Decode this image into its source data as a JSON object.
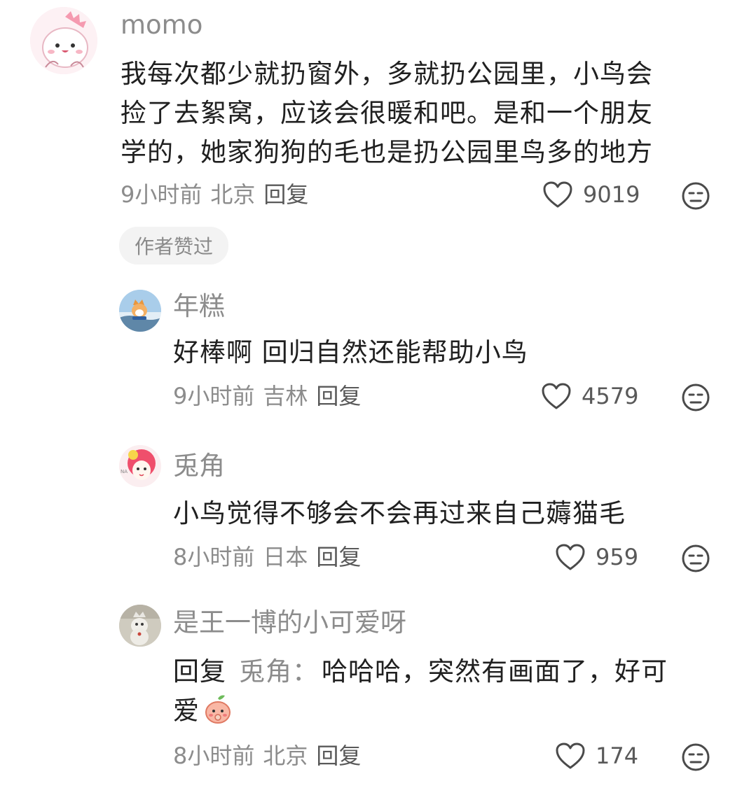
{
  "comments": [
    {
      "username": "momo",
      "content_lines": [
        "我每次都少就扔窗外，多就扔公园里，小鸟会",
        "捡了去絮窝，应该会很暖和吧。是和一个朋友",
        "学的，她家狗狗的毛也是扔公园里鸟多的地方"
      ],
      "time": "9小时前",
      "location": "北京",
      "reply_label": "回复",
      "likes": "9019",
      "badge": "作者赞过",
      "avatar_icon": "pink-dinosaur-avatar-icon"
    },
    {
      "username": "年糕",
      "content": "好棒啊 回归自然还能帮助小鸟",
      "time": "9小时前",
      "location": "吉林",
      "reply_label": "回复",
      "likes": "4579",
      "avatar_icon": "cat-seaside-avatar-icon"
    },
    {
      "username": "兎角",
      "content": "小鸟觉得不够会不会再过来自己薅猫毛",
      "time": "8小时前",
      "location": "日本",
      "reply_label": "回复",
      "likes": "959",
      "avatar_icon": "red-hair-girl-avatar-icon"
    },
    {
      "username": "是王一博的小可爱呀",
      "reply_prefix": "回复",
      "reply_target": "兎角：",
      "content_line1": "哈哈哈，突然有画面了，好可",
      "content_line2": "爱",
      "emoji_icon": "peach-shy-emoji-icon",
      "time": "8小时前",
      "location": "北京",
      "reply_label": "回复",
      "likes": "174",
      "avatar_icon": "cat-avatar-icon"
    }
  ],
  "icons": {
    "like": "heart-outline-icon",
    "dislike": "meh-face-icon"
  },
  "colors": {
    "secondary_text": "#8c8c8c",
    "primary_text": "#202020",
    "badge_bg": "#f3f3f3"
  }
}
